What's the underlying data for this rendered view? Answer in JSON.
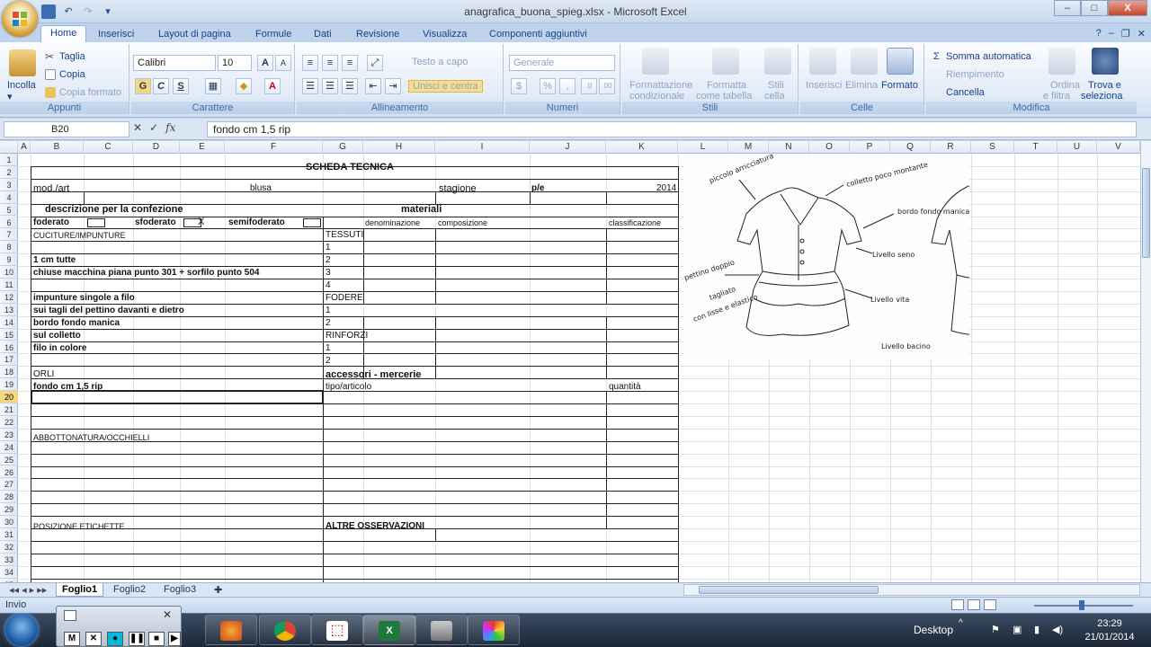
{
  "window": {
    "title": "anagrafica_buona_spieg.xlsx - Microsoft Excel",
    "minimize": "–",
    "maximize": "□",
    "close": "X"
  },
  "ribbon_tabs": [
    "Home",
    "Inserisci",
    "Layout di pagina",
    "Formule",
    "Dati",
    "Revisione",
    "Visualizza",
    "Componenti aggiuntivi"
  ],
  "ribbon": {
    "appunti": {
      "label": "Appunti",
      "incolla": "Incolla",
      "taglia": "Taglia",
      "copia": "Copia",
      "copia_formato": "Copia formato"
    },
    "carattere": {
      "label": "Carattere",
      "font": "Calibri",
      "size": "10",
      "bold": "G",
      "italic": "C",
      "underline": "S"
    },
    "allineamento": {
      "label": "Allineamento",
      "testo_a_capo": "Testo a capo",
      "unisci": "Unisci e centra"
    },
    "numeri": {
      "label": "Numeri",
      "format": "Generale"
    },
    "stili": {
      "label": "Stili",
      "formattazione": "Formattazione",
      "condizionale": "condizionale",
      "formatta": "Formatta",
      "come_tabella": "come tabella",
      "stili": "Stili",
      "cella": "cella"
    },
    "celle": {
      "label": "Celle",
      "inserisci": "Inserisci",
      "elimina": "Elimina",
      "formato": "Formato"
    },
    "modifica": {
      "label": "Modifica",
      "somma": "Somma automatica",
      "riempimento": "Riempimento",
      "cancella": "Cancella",
      "ordina": "Ordina",
      "filtra": "e filtra",
      "trova": "Trova e",
      "seleziona": "seleziona"
    }
  },
  "formula_bar": {
    "name_box": "B20",
    "fx": "fx",
    "value": "fondo cm 1,5 rip"
  },
  "columns": [
    "A",
    "B",
    "C",
    "D",
    "E",
    "F",
    "G",
    "H",
    "I",
    "J",
    "K",
    "L",
    "M",
    "N",
    "O",
    "P",
    "Q",
    "R",
    "S",
    "T",
    "U",
    "V"
  ],
  "rows": [
    "1",
    "2",
    "3",
    "4",
    "5",
    "6",
    "7",
    "8",
    "9",
    "10",
    "11",
    "12",
    "13",
    "14",
    "15",
    "16",
    "17",
    "18",
    "19",
    "20",
    "21",
    "22",
    "23",
    "24",
    "25",
    "26",
    "27",
    "28",
    "29",
    "30",
    "31",
    "32",
    "33",
    "34",
    "35"
  ],
  "selected_row": "20",
  "sheet": {
    "title": "SCHEDA TECNICA",
    "mod_art": "mod./art",
    "blusa": "blusa",
    "stagione": "stagione",
    "pe": "p/e",
    "year": "2014",
    "descrizione": "descrizione per la confezione",
    "materiali": "materiali",
    "foderato": "foderato",
    "sfoderato": "sfoderato",
    "x": "X",
    "semifoderato": "semifoderato",
    "denominazione": "denominazione",
    "composizione": "composizione",
    "classificazione": "classificazione",
    "cuciture": "CUCITURE/IMPUNTURE",
    "tessuti": "TESSUTI",
    "n1": "1",
    "n2": "2",
    "n3": "3",
    "n4": "4",
    "cm_tutte": "1 cm tutte",
    "chiuse": "chiuse macchina piana punto 301 + sorfilo punto 504",
    "impunture": "impunture singole a filo",
    "fodere": "FODERE",
    "sui_tagli": "sui tagli del pettino davanti e dietro",
    "bordo_fondo": "bordo fondo manica",
    "sul_colletto": "sul colletto",
    "rinforzi": "RINFORZI",
    "filo_colore": "filo in colore",
    "orli": "ORLI",
    "accessori": "accessori - mercerie",
    "fondo": "fondo cm 1,5 rip",
    "tipo": "tipo/articolo",
    "quantita": "quantità",
    "abbottonatura": "ABBOTTONATURA/OCCHIELLI",
    "posizione": "POSIZIONE ETICHETTE",
    "altre": "ALTRE OSSERVAZIONI"
  },
  "sketch_labels": {
    "piccolo": "piccolo arricciatura",
    "colletto": "colletto poco montante",
    "bordo": "bordo fondo manica",
    "livello_seno": "Livello seno",
    "livello_vita": "Livello vita",
    "livello_bacino": "Livello bacino",
    "pettino": "pettino doppio",
    "tagliato": "tagliato",
    "con_lisse": "con lisse e elastico"
  },
  "sheet_tabs": [
    "Foglio1",
    "Foglio2",
    "Foglio3"
  ],
  "status": {
    "mode": "Invio"
  },
  "taskbar": {
    "desktop": "Desktop",
    "time": "23:29",
    "date": "21/01/2014"
  },
  "mini_player": {
    "m": "M",
    "x": "✕"
  }
}
